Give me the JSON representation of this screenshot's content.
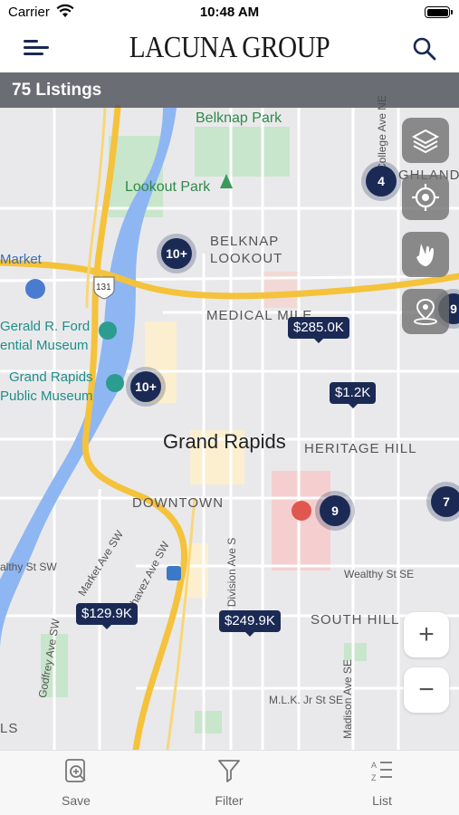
{
  "status": {
    "carrier": "Carrier",
    "time": "10:48 AM"
  },
  "header": {
    "logo": "LACUNA GROUP"
  },
  "map": {
    "listings_count": "75 Listings",
    "labels": {
      "belknap_park": "Belknap Park",
      "lookout_park": "Lookout Park",
      "belknap_lookout_1": "BELKNAP",
      "belknap_lookout_2": "LOOKOUT",
      "market": "Market",
      "medical_mile": "MEDICAL MILE",
      "ford_1": "Gerald R. Ford",
      "ford_2": "ential Museum",
      "gr_museum_1": "Grand Rapids",
      "gr_museum_2": "Public Museum",
      "city": "Grand Rapids",
      "heritage_hill": "HERITAGE HILL",
      "downtown": "DOWNTOWN",
      "market_ave": "Market Ave SW",
      "chavez": "Chavez Ave SW",
      "division": "Division Ave S",
      "wealthy_w": "althy St SW",
      "wealthy_e": "Wealthy St SE",
      "south_hill": "SOUTH HILL",
      "godfrey": "Godfrey Ave SW",
      "mlk": "M.L.K. Jr St SE",
      "madison": "Madison Ave SE",
      "college": "College Ave NE",
      "highland": "GHLAND",
      "hills_left": "LS",
      "route": "131"
    },
    "clusters": [
      "4",
      "10+",
      "10+",
      "9",
      "7",
      "9"
    ],
    "prices": [
      "$285.0K",
      "$1.2K",
      "$129.9K",
      "$249.9K"
    ]
  },
  "controls": {
    "zoom_in": "+",
    "zoom_out": "−"
  },
  "tabs": [
    {
      "label": "Save",
      "icon": "save-search-icon"
    },
    {
      "label": "Filter",
      "icon": "filter-icon"
    },
    {
      "label": "List",
      "icon": "list-icon"
    }
  ],
  "colors": {
    "navy": "#1b2a55",
    "highway": "#f5c23c",
    "river": "#8eb6f2",
    "park": "#c5e6c9"
  }
}
